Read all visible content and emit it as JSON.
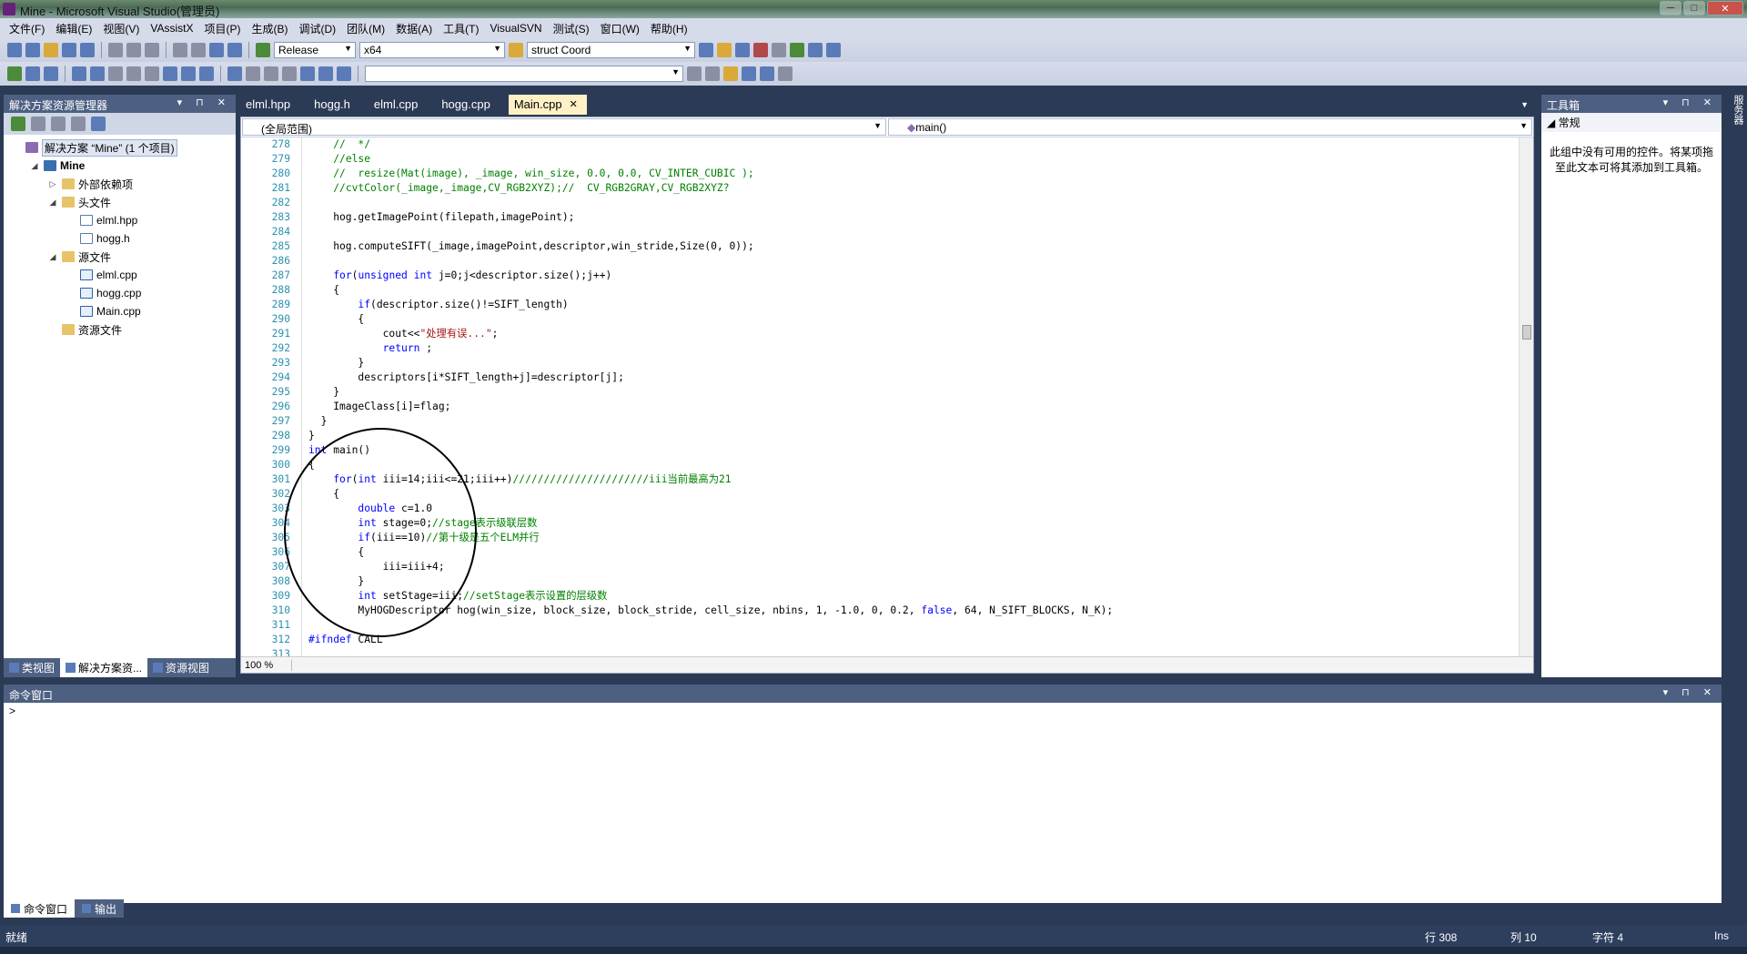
{
  "window": {
    "title": "Mine - Microsoft Visual Studio(管理员)",
    "minimize": "─",
    "maximize": "□",
    "close": "✕"
  },
  "menu": [
    "文件(F)",
    "编辑(E)",
    "视图(V)",
    "VAssistX",
    "项目(P)",
    "生成(B)",
    "调试(D)",
    "团队(M)",
    "数据(A)",
    "工具(T)",
    "VisualSVN",
    "测试(S)",
    "窗口(W)",
    "帮助(H)"
  ],
  "toolbar": {
    "config": "Release",
    "platform": "x64",
    "find_combo": "struct Coord"
  },
  "solution_explorer": {
    "title": "解决方案资源管理器",
    "tree": [
      {
        "label": "解决方案 “Mine” (1 个项目)",
        "icon": "solution-icon",
        "level": 0
      },
      {
        "label": "Mine",
        "icon": "project-icon",
        "level": 1,
        "expander": "◢"
      },
      {
        "label": "外部依赖项",
        "icon": "folder-icon",
        "level": 2,
        "expander": "▷"
      },
      {
        "label": "头文件",
        "icon": "folder-icon",
        "level": 2,
        "expander": "◢"
      },
      {
        "label": "elml.hpp",
        "icon": "header-file-icon",
        "level": 3
      },
      {
        "label": "hogg.h",
        "icon": "header-file-icon",
        "level": 3
      },
      {
        "label": "源文件",
        "icon": "folder-icon",
        "level": 2,
        "expander": "◢"
      },
      {
        "label": "elml.cpp",
        "icon": "cpp-file-icon",
        "level": 3
      },
      {
        "label": "hogg.cpp",
        "icon": "cpp-file-icon",
        "level": 3
      },
      {
        "label": "Main.cpp",
        "icon": "cpp-file-icon",
        "level": 3
      },
      {
        "label": "资源文件",
        "icon": "folder-icon",
        "level": 2
      }
    ],
    "tabs": [
      "类视图",
      "解决方案资...",
      "资源视图"
    ]
  },
  "editor": {
    "tabs": [
      "elml.hpp",
      "hogg.h",
      "elml.cpp",
      "hogg.cpp",
      "Main.cpp"
    ],
    "active_tab": "Main.cpp",
    "scope_combo": "(全局范围)",
    "member_combo": "main()",
    "zoom": "100 %",
    "lines": [
      {
        "n": "278",
        "code": "    //  */"
      },
      {
        "n": "279",
        "code": "    //else"
      },
      {
        "n": "280",
        "code": "    //  resize(Mat(image), _image, win_size, 0.0, 0.0, CV_INTER_CUBIC );"
      },
      {
        "n": "281",
        "code": "    //cvtColor(_image,_image,CV_RGB2XYZ);//  CV_RGB2GRAY,CV_RGB2XYZ?"
      },
      {
        "n": "282",
        "code": ""
      },
      {
        "n": "283",
        "code": "    hog.getImagePoint(filepath,imagePoint);"
      },
      {
        "n": "284",
        "code": ""
      },
      {
        "n": "285",
        "code": "    hog.computeSIFT(_image,imagePoint,descriptor,win_stride,Size(0, 0));"
      },
      {
        "n": "286",
        "code": ""
      },
      {
        "n": "287",
        "code": "    for(unsigned int j=0;j<descriptor.size();j++)"
      },
      {
        "n": "288",
        "code": "    {"
      },
      {
        "n": "289",
        "code": "        if(descriptor.size()!=SIFT_length)"
      },
      {
        "n": "290",
        "code": "        {"
      },
      {
        "n": "291",
        "code": "            cout<<\"处理有误...\";"
      },
      {
        "n": "292",
        "code": "            return ;"
      },
      {
        "n": "293",
        "code": "        }"
      },
      {
        "n": "294",
        "code": "        descriptors[i*SIFT_length+j]=descriptor[j];"
      },
      {
        "n": "295",
        "code": "    }"
      },
      {
        "n": "296",
        "code": "    ImageClass[i]=flag;"
      },
      {
        "n": "297",
        "code": "  }"
      },
      {
        "n": "298",
        "code": "}"
      },
      {
        "n": "299",
        "code": "int main()"
      },
      {
        "n": "300",
        "code": "{"
      },
      {
        "n": "301",
        "code": "    for(int iii=14;iii<=21;iii++)//////////////////////iii当前最高为21"
      },
      {
        "n": "302",
        "code": "    {"
      },
      {
        "n": "303",
        "code": "        double c=1.0"
      },
      {
        "n": "304",
        "code": "        int stage=0;//stage表示级联层数"
      },
      {
        "n": "305",
        "code": "        if(iii==10)//第十级是五个ELM并行"
      },
      {
        "n": "306",
        "code": "        {"
      },
      {
        "n": "307",
        "code": "            iii=iii+4;"
      },
      {
        "n": "308",
        "code": "        }"
      },
      {
        "n": "309",
        "code": "        int setStage=iii;//setStage表示设置的层级数"
      },
      {
        "n": "310",
        "code": "        MyHOGDescriptor hog(win_size, block_size, block_stride, cell_size, nbins, 1, -1.0, 0, 0.2, false, 64, N_SIFT_BLOCKS, N_K);"
      },
      {
        "n": "311",
        "code": ""
      },
      {
        "n": "312",
        "code": "#ifndef CALL"
      },
      {
        "n": "313",
        "code": ""
      }
    ]
  },
  "toolbox": {
    "title": "工具箱",
    "section": "常规",
    "empty_message": "此组中没有可用的控件。将某项拖至此文本可将其添加到工具箱。"
  },
  "side_strip": "服务器",
  "command_window": {
    "title": "命令窗口",
    "prompt": ">",
    "tabs": [
      "命令窗口",
      "输出"
    ]
  },
  "status": {
    "ready": "就绪",
    "line": "行 308",
    "col": "列 10",
    "char": "字符 4",
    "ins": "Ins"
  },
  "colors": {
    "keyword": "#0000ff",
    "comment": "#008000",
    "string": "#a31515",
    "line_number": "#2b91af"
  }
}
